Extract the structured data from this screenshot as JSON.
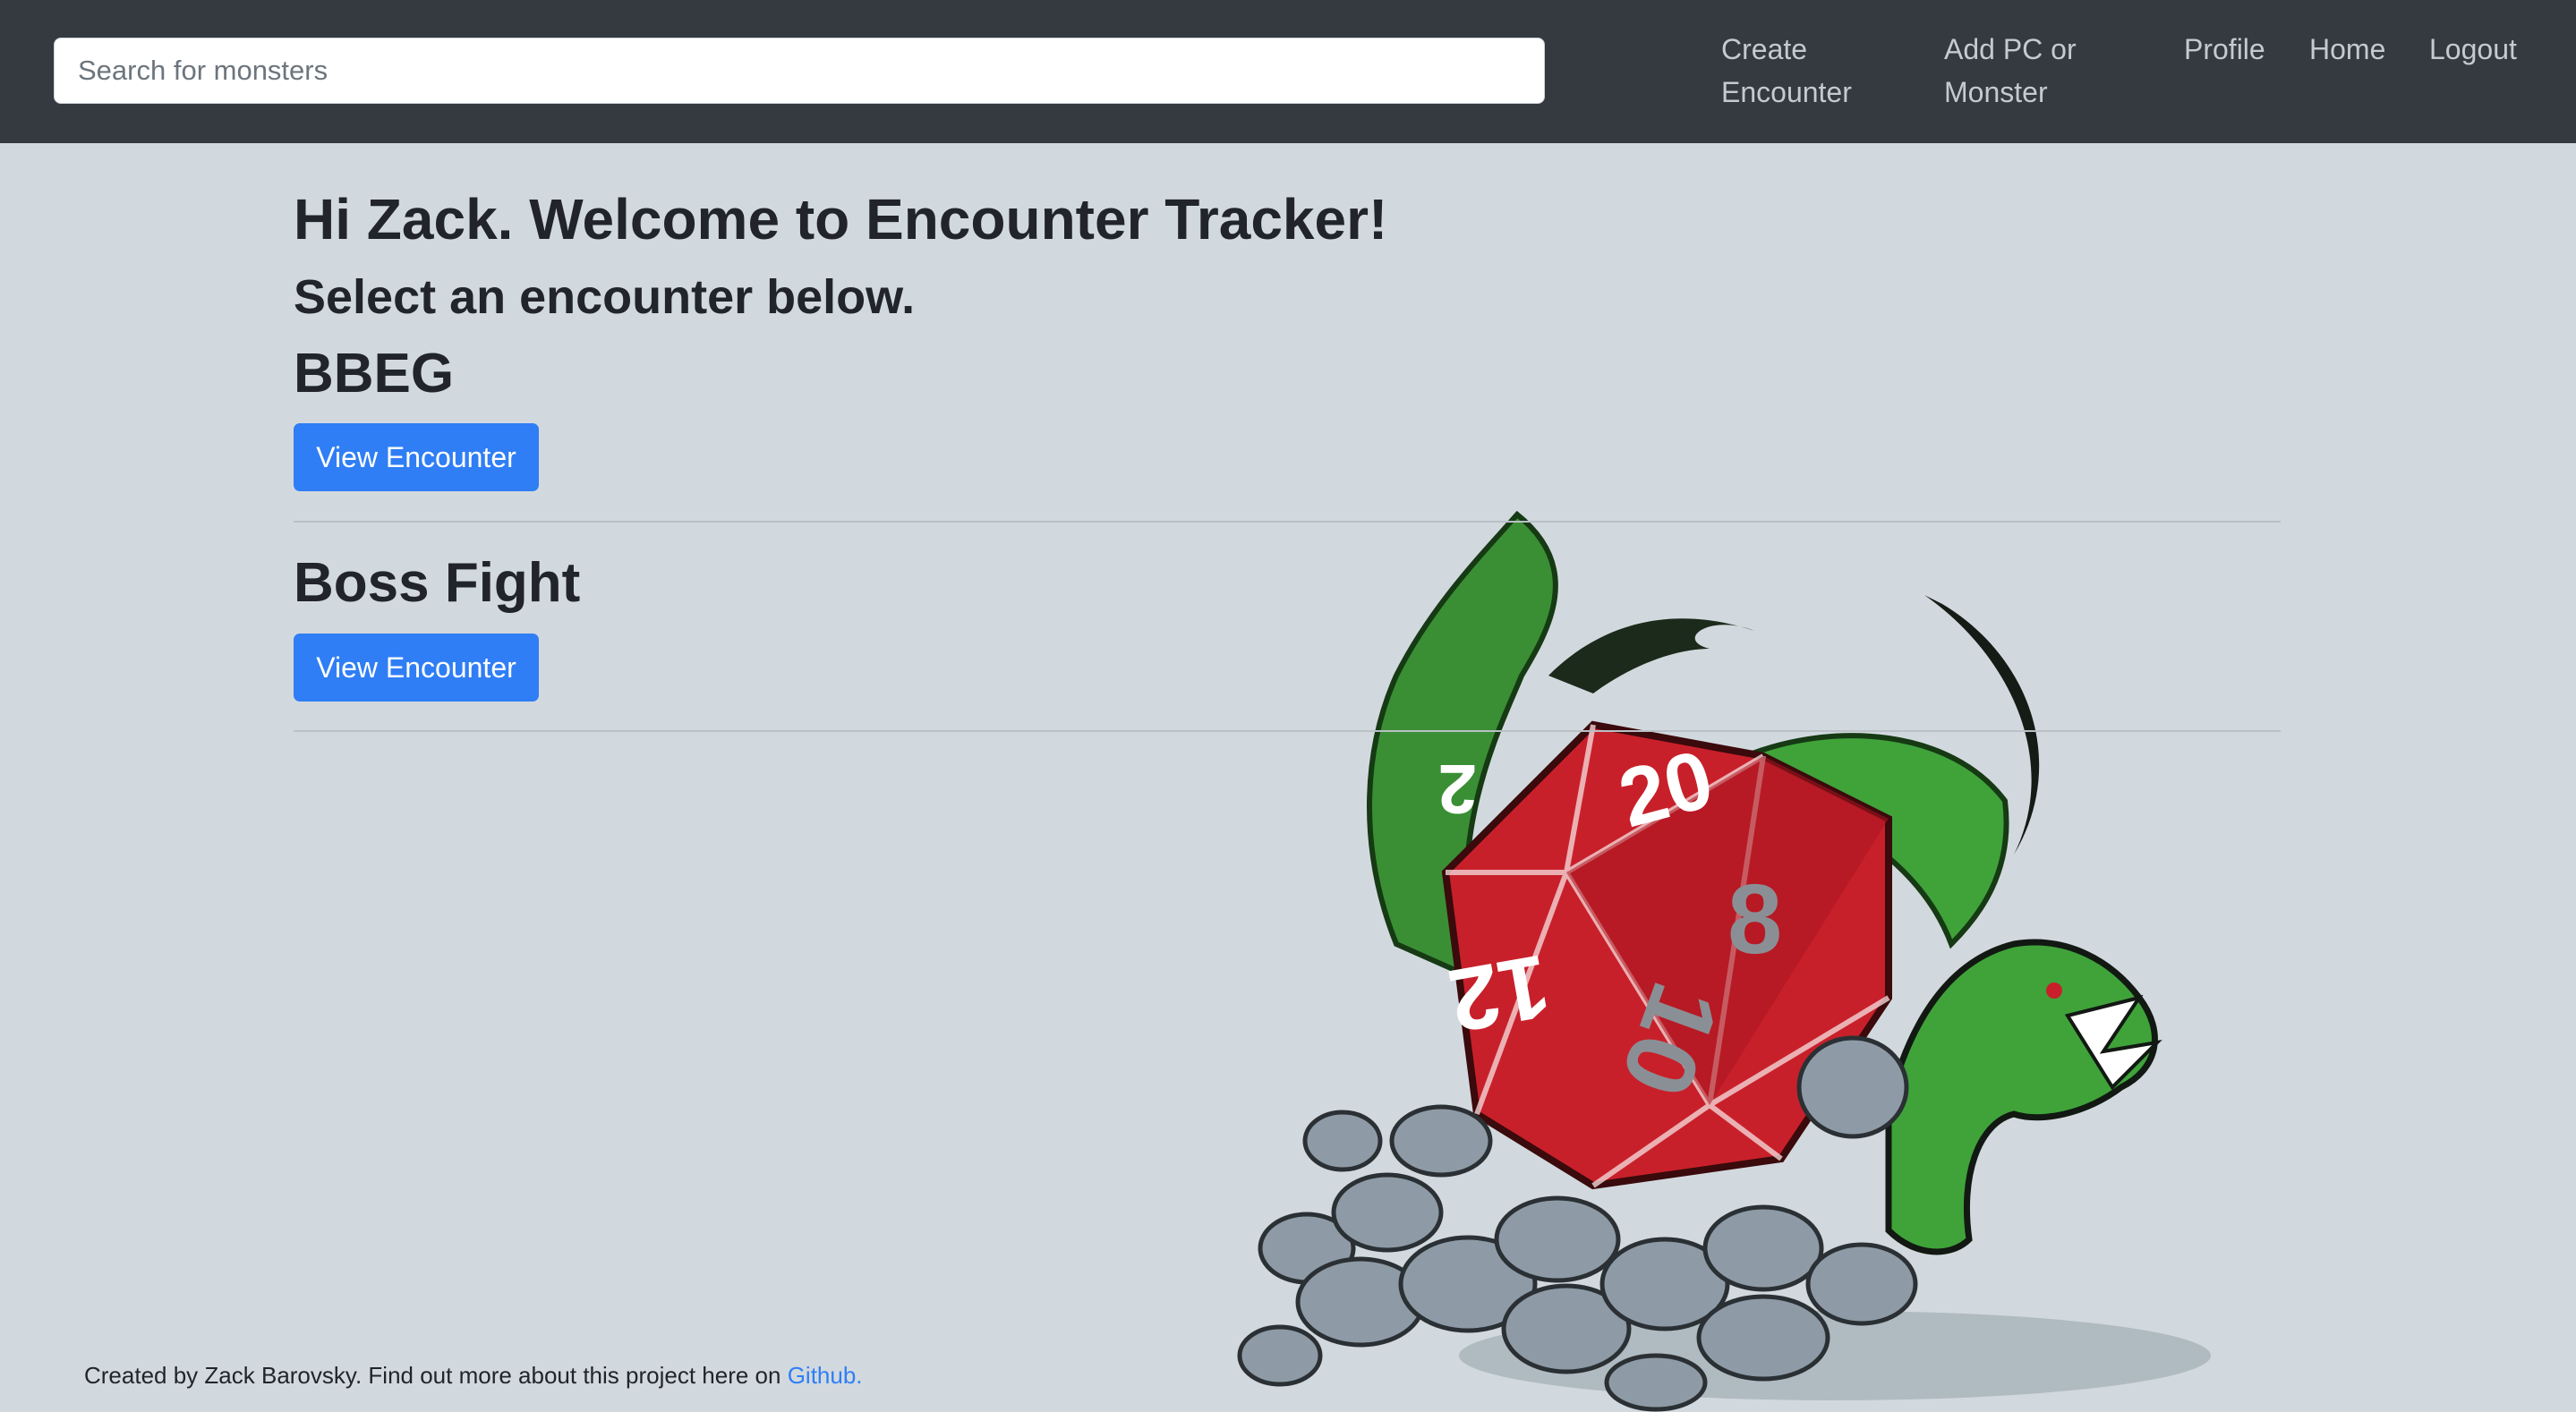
{
  "nav": {
    "search_placeholder": "Search for monsters",
    "links": [
      {
        "label": "Create Encounter"
      },
      {
        "label": "Add PC or Monster"
      },
      {
        "label": "Profile"
      },
      {
        "label": "Home"
      },
      {
        "label": "Logout"
      }
    ]
  },
  "main": {
    "welcome": "Hi Zack. Welcome to Encounter Tracker!",
    "subtitle": "Select an encounter below.",
    "encounters": [
      {
        "name": "BBEG",
        "button": "View Encounter"
      },
      {
        "name": "Boss Fight",
        "button": "View Encounter"
      }
    ]
  },
  "footer": {
    "text": "Created by Zack Barovsky. Find out more about this project here on ",
    "link": "Github."
  },
  "colors": {
    "navbar": "#343a40",
    "background": "#d2d9de",
    "primary": "#2f7ef5",
    "dice_red": "#c8202a",
    "dragon_green": "#3fa33a"
  }
}
